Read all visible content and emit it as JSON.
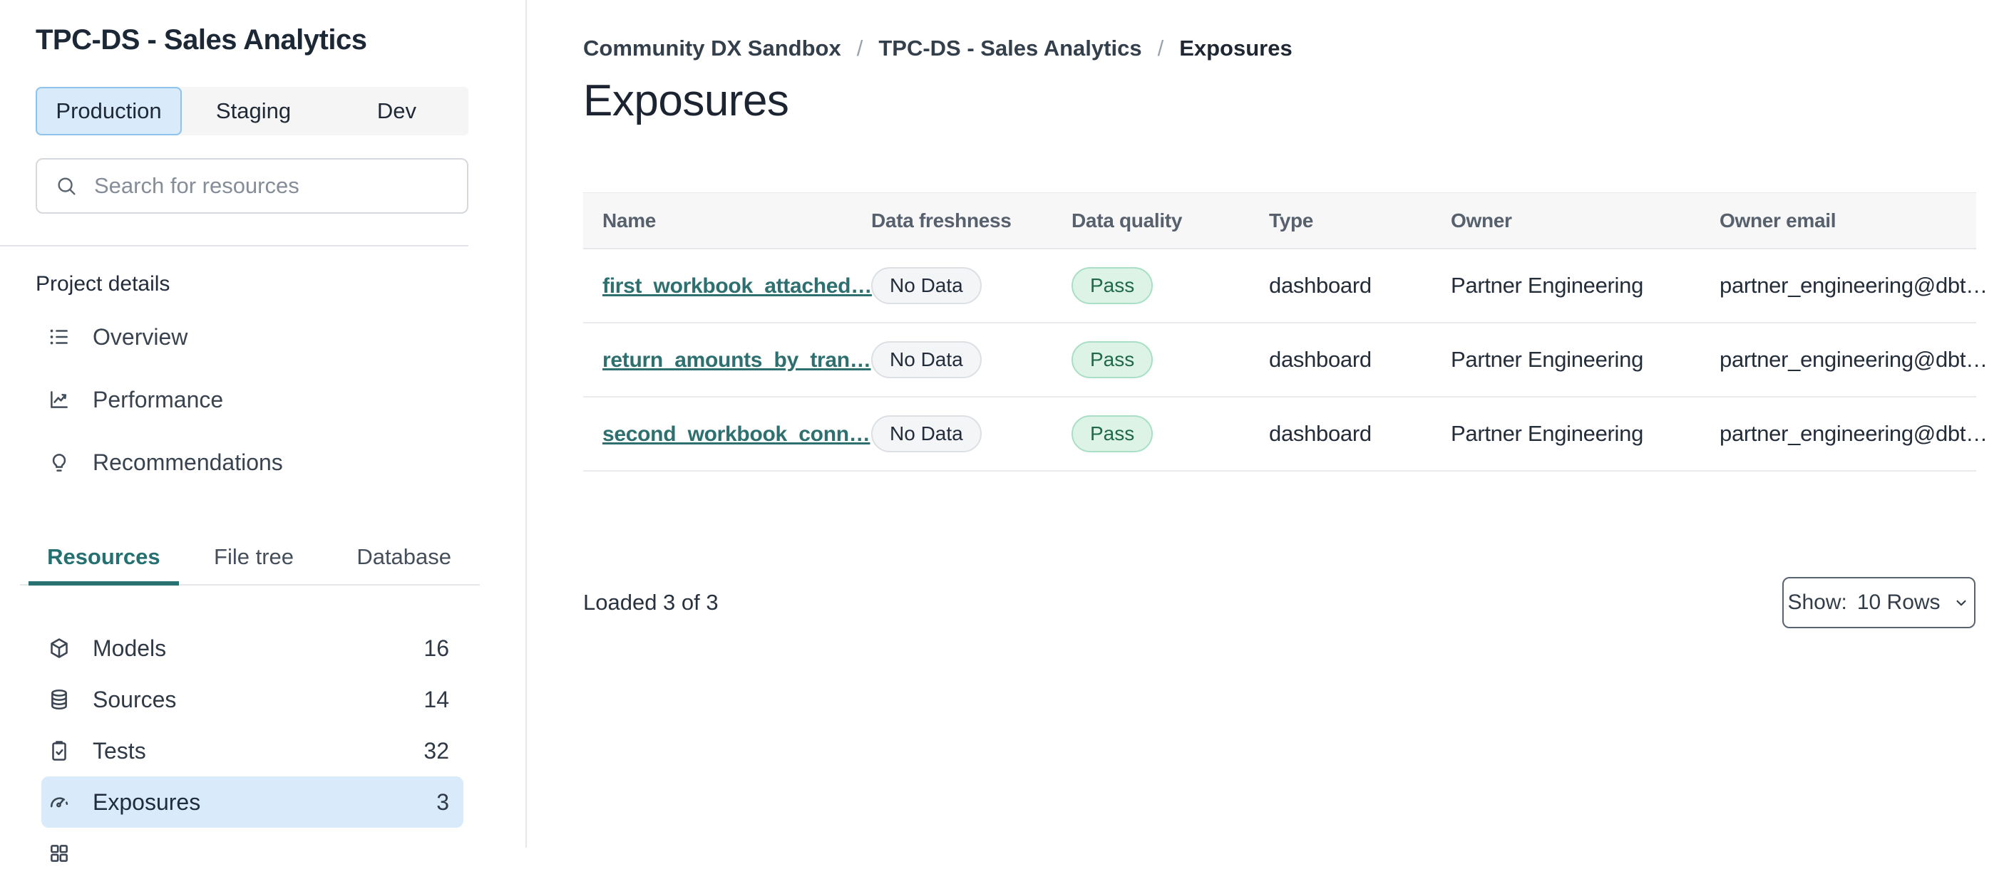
{
  "sidebar": {
    "title": "TPC-DS - Sales Analytics",
    "env_tabs": [
      {
        "label": "Production",
        "active": true
      },
      {
        "label": "Staging",
        "active": false
      },
      {
        "label": "Dev",
        "active": false
      }
    ],
    "search": {
      "placeholder": "Search for resources",
      "value": "",
      "icon": "search-icon"
    },
    "section_label": "Project details",
    "nav": [
      {
        "label": "Overview",
        "icon": "list-icon"
      },
      {
        "label": "Performance",
        "icon": "chart-line-icon"
      },
      {
        "label": "Recommendations",
        "icon": "lightbulb-icon"
      }
    ],
    "view_tabs": [
      {
        "label": "Resources",
        "active": true
      },
      {
        "label": "File tree",
        "active": false
      },
      {
        "label": "Database",
        "active": false
      }
    ],
    "resources": [
      {
        "label": "Models",
        "count": "16",
        "icon": "package-icon",
        "selected": false
      },
      {
        "label": "Sources",
        "count": "14",
        "icon": "database-icon",
        "selected": false
      },
      {
        "label": "Tests",
        "count": "32",
        "icon": "clipboard-check-icon",
        "selected": false
      },
      {
        "label": "Exposures",
        "count": "3",
        "icon": "gauge-icon",
        "selected": true
      }
    ]
  },
  "main": {
    "breadcrumb": {
      "items": [
        "Community DX Sandbox",
        "TPC-DS - Sales Analytics",
        "Exposures"
      ],
      "separator": "/"
    },
    "title": "Exposures",
    "table": {
      "columns": [
        "Name",
        "Data freshness",
        "Data quality",
        "Type",
        "Owner",
        "Owner email"
      ],
      "rows": [
        {
          "name": "first_workbook_attached…",
          "freshness": "No Data",
          "quality": "Pass",
          "type": "dashboard",
          "owner": "Partner Engineering",
          "owner_email": "partner_engineering@dbt…"
        },
        {
          "name": "return_amounts_by_tran…",
          "freshness": "No Data",
          "quality": "Pass",
          "type": "dashboard",
          "owner": "Partner Engineering",
          "owner_email": "partner_engineering@dbt…"
        },
        {
          "name": "second_workbook_conn…",
          "freshness": "No Data",
          "quality": "Pass",
          "type": "dashboard",
          "owner": "Partner Engineering",
          "owner_email": "partner_engineering@dbt…"
        }
      ]
    },
    "footer": {
      "loaded_text": "Loaded 3 of 3",
      "show_label": "Show:",
      "show_value": "10 Rows"
    }
  },
  "colors": {
    "accent_teal": "#2a7171",
    "link_teal": "#2e6f6f",
    "selected_blue_bg": "#d9eafb",
    "env_active_bg": "#d9eafa",
    "env_active_border": "#8fc3ec",
    "badge_gray_bg": "#f4f5f7",
    "badge_green_bg": "#dcf3e6",
    "badge_green_text": "#20684a",
    "table_header_bg": "#f7f7f8",
    "border_gray": "#e5e7ea"
  }
}
